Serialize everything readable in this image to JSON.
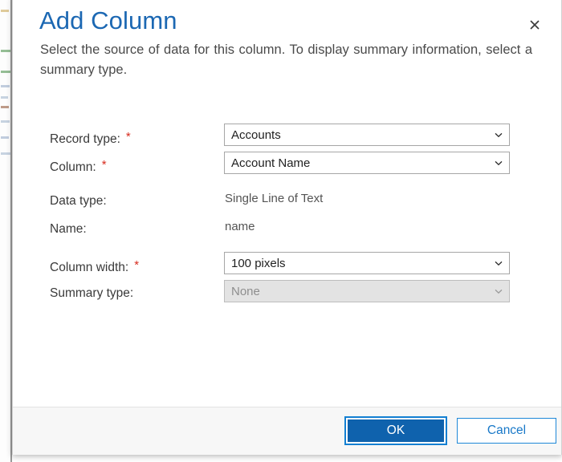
{
  "dialog": {
    "title": "Add Column",
    "description": "Select the source of data for this column. To display summary information, select a summary type.",
    "close_icon": "close-icon",
    "accent_color": "#1c68b3",
    "required_marker": "*",
    "required_color": "#d72b1e"
  },
  "form": {
    "fields": [
      {
        "label": "Record type:",
        "required": true,
        "control": "dropdown",
        "value": "Accounts",
        "disabled": false
      },
      {
        "label": "Column:",
        "required": true,
        "control": "dropdown",
        "value": "Account Name",
        "disabled": false
      },
      {
        "label": "Data type:",
        "required": false,
        "control": "static",
        "value": "Single Line of Text",
        "disabled": false
      },
      {
        "label": "Name:",
        "required": false,
        "control": "static",
        "value": "name",
        "disabled": false
      },
      {
        "label": "Column width:",
        "required": true,
        "control": "dropdown",
        "value": "100 pixels",
        "disabled": false
      },
      {
        "label": "Summary type:",
        "required": false,
        "control": "dropdown",
        "value": "None",
        "disabled": true
      }
    ]
  },
  "footer": {
    "ok_label": "OK",
    "cancel_label": "Cancel",
    "ok_color": "#0f62ad",
    "cancel_color": "#1878c8"
  }
}
